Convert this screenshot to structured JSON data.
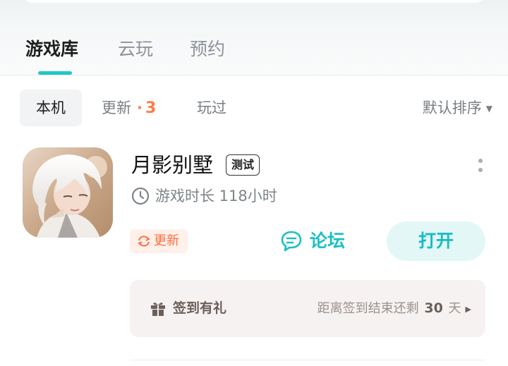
{
  "tabs": [
    {
      "label": "游戏库",
      "active": true
    },
    {
      "label": "云玩",
      "active": false
    },
    {
      "label": "预约",
      "active": false
    }
  ],
  "filters": {
    "local": "本机",
    "updates_label": "更新",
    "updates_count": "3",
    "played": "玩过",
    "sort_label": "默认排序"
  },
  "game": {
    "title": "月影别墅",
    "tag": "测试",
    "playtime": "游戏时长 118小时",
    "update_label": "更新",
    "forum_label": "论坛",
    "open_label": "打开",
    "icon": "character-portrait-app-icon"
  },
  "checkin": {
    "title": "签到有礼",
    "prefix": "距离签到结束还剩",
    "days": "30",
    "suffix": "天"
  },
  "colors": {
    "accent": "#1ec8c8",
    "update_orange": "#ff6b3d",
    "count_orange": "#ff7b47"
  }
}
